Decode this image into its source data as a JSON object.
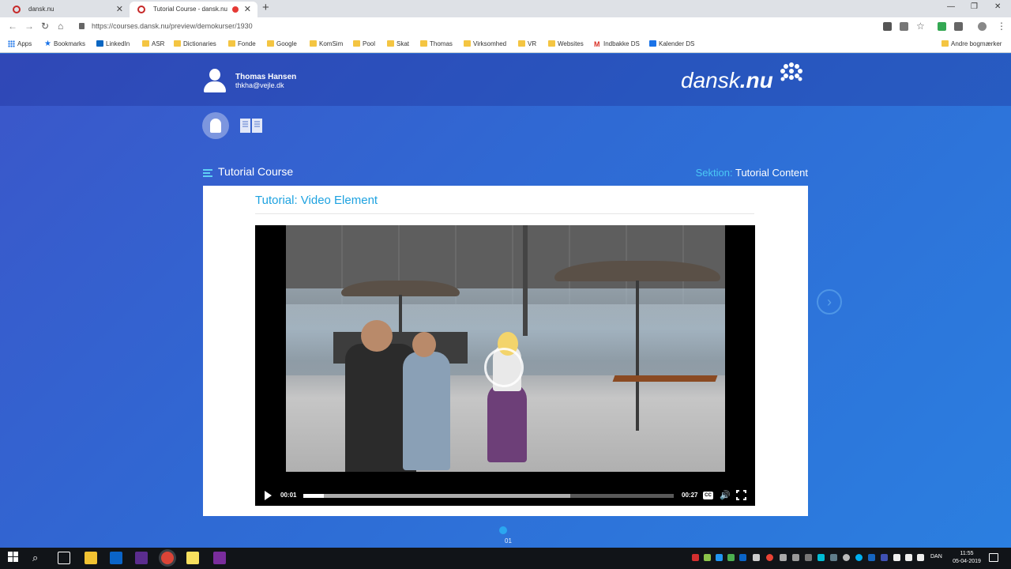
{
  "browser": {
    "tabs": [
      {
        "title": "dansk.nu",
        "active": false
      },
      {
        "title": "Tutorial Course - dansk.nu",
        "active": true
      }
    ],
    "url": "https://courses.dansk.nu/preview/demokurser/1930",
    "bookmarks": [
      {
        "label": "Apps",
        "icon": "apps-grid-icon"
      },
      {
        "label": "Bookmarks",
        "icon": "star-icon"
      },
      {
        "label": "LinkedIn",
        "icon": "linkedin-icon"
      },
      {
        "label": "ASR",
        "icon": "folder-icon"
      },
      {
        "label": "Dictionaries",
        "icon": "folder-icon"
      },
      {
        "label": "Fonde",
        "icon": "folder-icon"
      },
      {
        "label": "Google",
        "icon": "folder-icon"
      },
      {
        "label": "KomSim",
        "icon": "folder-icon"
      },
      {
        "label": "Pool",
        "icon": "folder-icon"
      },
      {
        "label": "Skat",
        "icon": "folder-icon"
      },
      {
        "label": "Thomas",
        "icon": "folder-icon"
      },
      {
        "label": "Virksomhed",
        "icon": "folder-icon"
      },
      {
        "label": "VR",
        "icon": "folder-icon"
      },
      {
        "label": "Websites",
        "icon": "folder-icon"
      },
      {
        "label": "Indbakke DS",
        "icon": "gmail-icon"
      },
      {
        "label": "Kalender DS",
        "icon": "calendar-icon"
      }
    ],
    "other_bookmarks": "Andre bogmærker"
  },
  "header": {
    "user_name": "Thomas Hansen",
    "user_email": "thkha@vejle.dk",
    "logo_text": "dansk",
    "logo_bold": ".nu"
  },
  "course": {
    "title": "Tutorial Course",
    "section_label": "Sektion:",
    "section_value": "Tutorial Content",
    "element_title": "Tutorial: Video Element"
  },
  "video": {
    "current_time": "00:01",
    "duration": "00:27",
    "progress_fraction": 0.056,
    "buffered_fraction": 0.72,
    "cc_label": "CC"
  },
  "pager": {
    "page": "01"
  },
  "taskbar": {
    "language": "DAN",
    "time": "11:55",
    "date": "05-04-2019"
  },
  "colors": {
    "accent": "#1ea2e0",
    "section_label": "#4ac8f5",
    "page_bg": "#2f6ad4"
  }
}
